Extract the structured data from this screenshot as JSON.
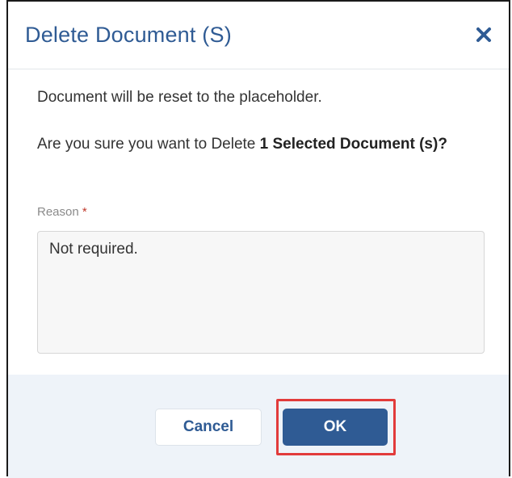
{
  "dialog": {
    "title": "Delete Document (S)",
    "close_icon": "close-icon"
  },
  "body": {
    "message": "Document will be reset to the placeholder.",
    "confirm_prefix": "Are you sure you want to Delete ",
    "confirm_bold": "1 Selected Document (s)?",
    "reason_label": "Reason",
    "reason_required": "*",
    "reason_value": "Not required."
  },
  "footer": {
    "cancel_label": "Cancel",
    "ok_label": "OK"
  },
  "colors": {
    "title": "#2f5b94",
    "primary_button": "#2f5b94",
    "footer_bg": "#eef3f9",
    "highlight": "#e23b3b",
    "required": "#c0392b"
  }
}
